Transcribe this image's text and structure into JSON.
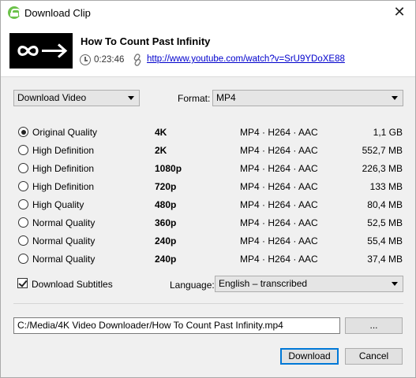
{
  "window": {
    "title": "Download Clip",
    "close_symbol": "✕"
  },
  "clip": {
    "title": "How To Count Past Infinity",
    "duration": "0:23:46",
    "url": "http://www.youtube.com/watch?v=SrU9YDoXE88",
    "thumbnail_icon": "infinity-arrow-icon"
  },
  "mode": {
    "selected": "Download Video"
  },
  "format": {
    "label": "Format:",
    "selected": "MP4"
  },
  "qualities": [
    {
      "name": "Original Quality",
      "resolution": "4K",
      "codec": "MP4 · H264 · AAC",
      "size": "1,1 GB",
      "checked": true
    },
    {
      "name": "High Definition",
      "resolution": "2K",
      "codec": "MP4 · H264 · AAC",
      "size": "552,7 MB",
      "checked": false
    },
    {
      "name": "High Definition",
      "resolution": "1080p",
      "codec": "MP4 · H264 · AAC",
      "size": "226,3 MB",
      "checked": false
    },
    {
      "name": "High Definition",
      "resolution": "720p",
      "codec": "MP4 · H264 · AAC",
      "size": "133 MB",
      "checked": false
    },
    {
      "name": "High Quality",
      "resolution": "480p",
      "codec": "MP4 · H264 · AAC",
      "size": "80,4 MB",
      "checked": false
    },
    {
      "name": "Normal Quality",
      "resolution": "360p",
      "codec": "MP4 · H264 · AAC",
      "size": "52,5 MB",
      "checked": false
    },
    {
      "name": "Normal Quality",
      "resolution": "240p",
      "codec": "MP4 · H264 · AAC",
      "size": "55,4 MB",
      "checked": false
    },
    {
      "name": "Normal Quality",
      "resolution": "240p",
      "codec": "MP4 · H264 · AAC",
      "size": "37,4 MB",
      "checked": false
    }
  ],
  "subtitles": {
    "label": "Download Subtitles",
    "checked": true,
    "language_label": "Language:",
    "language": "English – transcribed"
  },
  "output": {
    "path": "C:/Media/4K Video Downloader/How To Count Past Infinity.mp4",
    "browse_label": "..."
  },
  "actions": {
    "download_label": "Download",
    "cancel_label": "Cancel"
  },
  "colors": {
    "accent": "#0078d7",
    "link": "#0000cc",
    "app_icon": "#6cc24a"
  }
}
